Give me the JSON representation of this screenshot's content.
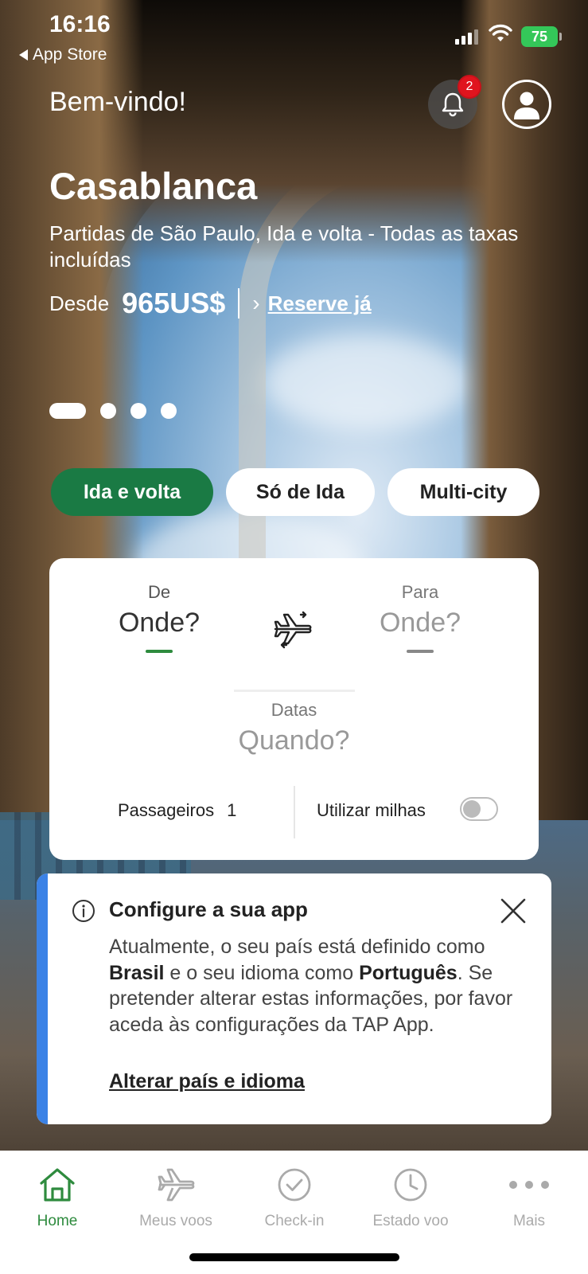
{
  "status_bar": {
    "time": "16:16",
    "back_app": "App Store",
    "battery": "75"
  },
  "header": {
    "welcome": "Bem-vindo!",
    "notification_count": "2"
  },
  "promo": {
    "city": "Casablanca",
    "subtitle": "Partidas de São Paulo, Ida e volta - Todas as taxas incluídas",
    "from_label": "Desde",
    "price": "965US$",
    "cta": "Reserve já",
    "carousel_total": 4,
    "carousel_active": 1
  },
  "trip_types": [
    {
      "label": "Ida e volta",
      "active": true
    },
    {
      "label": "Só de Ida",
      "active": false
    },
    {
      "label": "Multi-city",
      "active": false
    }
  ],
  "search": {
    "from_label": "De",
    "from_value": "Onde?",
    "to_label": "Para",
    "to_value": "Onde?",
    "dates_label": "Datas",
    "dates_value": "Quando?",
    "passengers_label": "Passageiros",
    "passengers_count": "1",
    "miles_label": "Utilizar milhas",
    "miles_enabled": false
  },
  "notice": {
    "title": "Configure a sua app",
    "body_part1": "Atualmente, o seu país está definido como ",
    "country": "Brasil",
    "body_part2": " e o seu idioma como ",
    "language": "Português",
    "body_part3": ". Se pretender alterar estas informações, por favor aceda às configurações da TAP App.",
    "link": "Alterar país e idioma"
  },
  "nav": [
    {
      "label": "Home",
      "icon": "home-icon",
      "active": true
    },
    {
      "label": "Meus voos",
      "icon": "plane-icon",
      "active": false
    },
    {
      "label": "Check-in",
      "icon": "check-circle-icon",
      "active": false
    },
    {
      "label": "Estado voo",
      "icon": "clock-icon",
      "active": false
    },
    {
      "label": "Mais",
      "icon": "more-icon",
      "active": false
    }
  ],
  "colors": {
    "brand_green": "#1a7a44",
    "accent_green": "#2e8b3e",
    "badge_red": "#e0141e",
    "notice_accent": "#3b82e6"
  }
}
